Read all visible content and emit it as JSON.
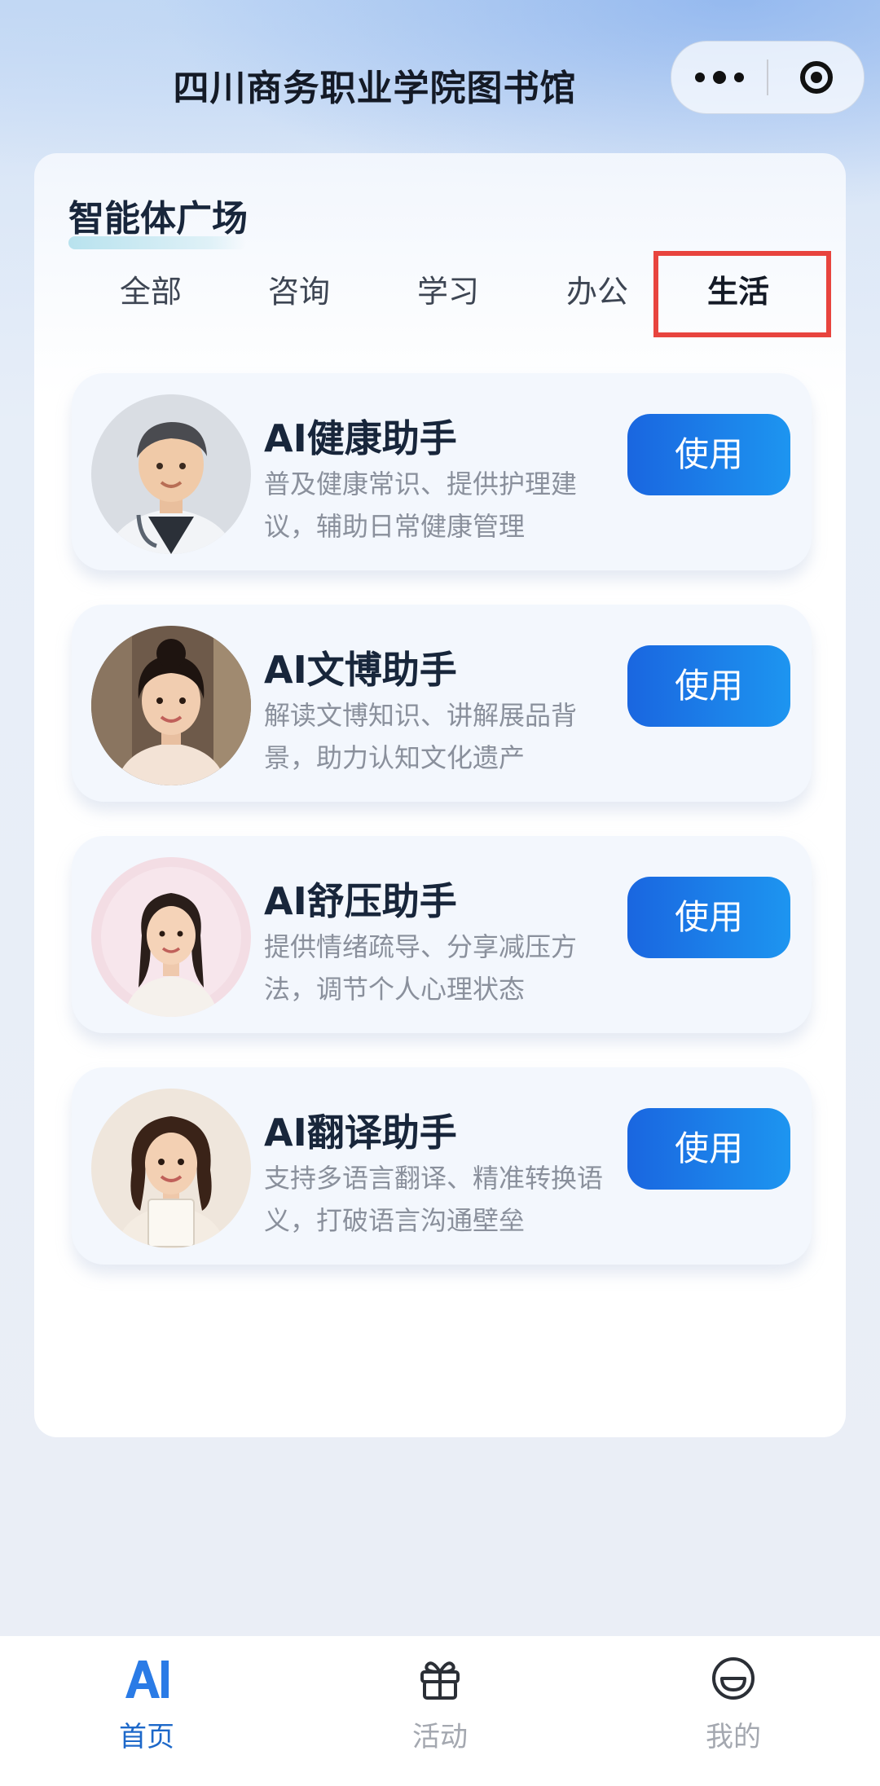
{
  "header": {
    "title": "四川商务职业学院图书馆"
  },
  "section": {
    "title": "智能体广场"
  },
  "tabs": [
    {
      "label": "全部"
    },
    {
      "label": "咨询"
    },
    {
      "label": "学习"
    },
    {
      "label": "办公"
    },
    {
      "label": "生活",
      "active": true
    }
  ],
  "agents": [
    {
      "name": "AI健康助手",
      "desc": "普及健康常识、提供护理建议，辅助日常健康管理",
      "button": "使用"
    },
    {
      "name": "AI文博助手",
      "desc": "解读文博知识、讲解展品背景，助力认知文化遗产",
      "button": "使用"
    },
    {
      "name": "AI舒压助手",
      "desc": "提供情绪疏导、分享减压方法，调节个人心理状态",
      "button": "使用"
    },
    {
      "name": "AI翻译助手",
      "desc": "支持多语言翻译、精准转换语义，打破语言沟通壁垒",
      "button": "使用"
    }
  ],
  "bottom_nav": [
    {
      "label": "首页",
      "icon": "ai-logo-icon",
      "active": true
    },
    {
      "label": "活动",
      "icon": "gift-icon"
    },
    {
      "label": "我的",
      "icon": "smile-icon"
    }
  ],
  "colors": {
    "accent": "#1a66e0",
    "highlight": "#e8443e",
    "nav_active": "#1d68c9"
  }
}
